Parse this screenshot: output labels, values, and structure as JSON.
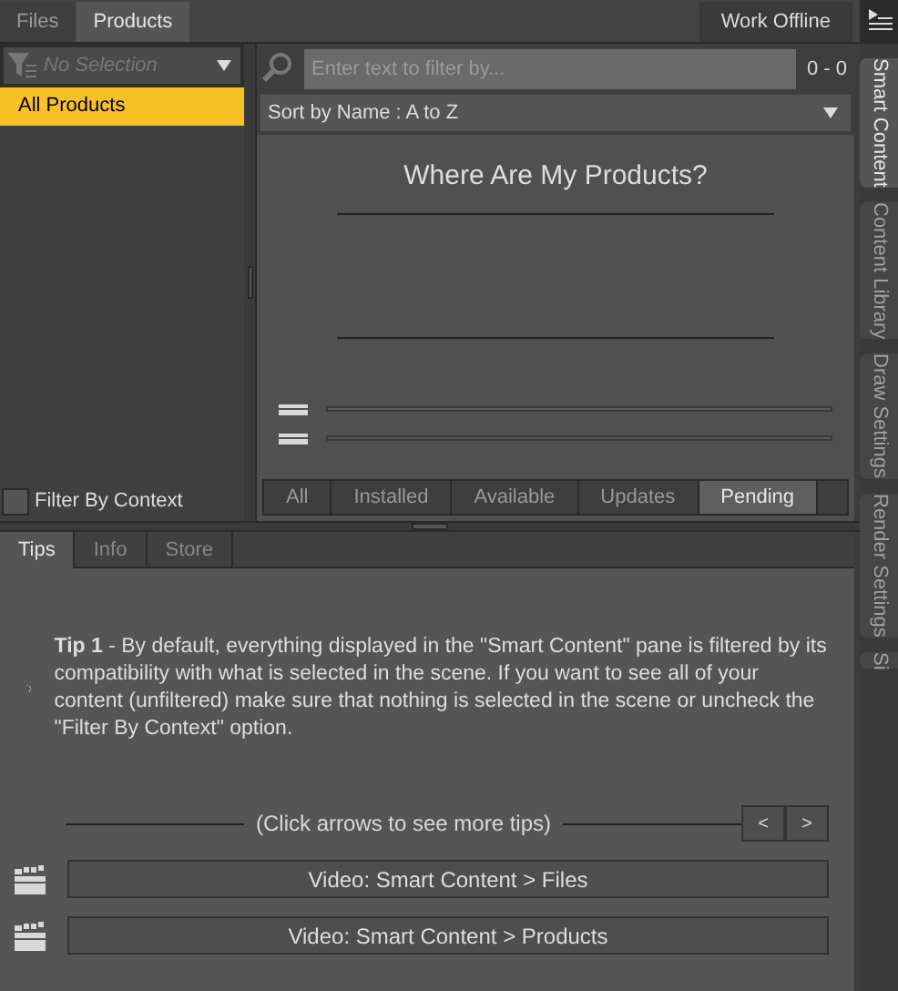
{
  "top_tabs": [
    {
      "label": "Files",
      "selected": false
    },
    {
      "label": "Products",
      "selected": true
    }
  ],
  "work_offline": "Work Offline",
  "category_filter": {
    "placeholder": "No Selection"
  },
  "categories": [
    {
      "label": "All Products",
      "selected": true
    }
  ],
  "filter_by_context": {
    "label": "Filter By Context",
    "checked": false
  },
  "search": {
    "placeholder": "Enter text to filter by...",
    "count": "0 - 0"
  },
  "sort": "Sort by Name : A to Z",
  "heading": "Where Are My Products?",
  "status_tabs": [
    {
      "label": "All",
      "selected": false
    },
    {
      "label": "Installed",
      "selected": false
    },
    {
      "label": "Available",
      "selected": false
    },
    {
      "label": "Updates",
      "selected": false
    },
    {
      "label": "Pending",
      "selected": true
    }
  ],
  "bottom_tabs": [
    {
      "label": "Tips",
      "selected": true
    },
    {
      "label": "Info",
      "selected": false
    },
    {
      "label": "Store",
      "selected": false
    }
  ],
  "tip": "**Tip 1** - By default, everything displayed in the \"Smart Content\" pane is filtered by its compatibility with what is selected in the scene. If you want to see all of your content (unfiltered) make sure that nothing is selected in the scene or uncheck the \"Filter By Context\" option.",
  "tips_hint": "(Click arrows to see more tips)",
  "nav_buttons": [
    "<",
    ">"
  ],
  "videos": [
    "Video: Smart Content > Files",
    "Video: Smart Content > Products"
  ],
  "side_tabs": [
    {
      "label": "Smart Content",
      "selected": true
    },
    {
      "label": "Content Library",
      "selected": false
    },
    {
      "label": "Draw Settings",
      "selected": false
    },
    {
      "label": "Render Settings",
      "selected": false
    },
    {
      "label": "Si",
      "selected": false
    }
  ]
}
